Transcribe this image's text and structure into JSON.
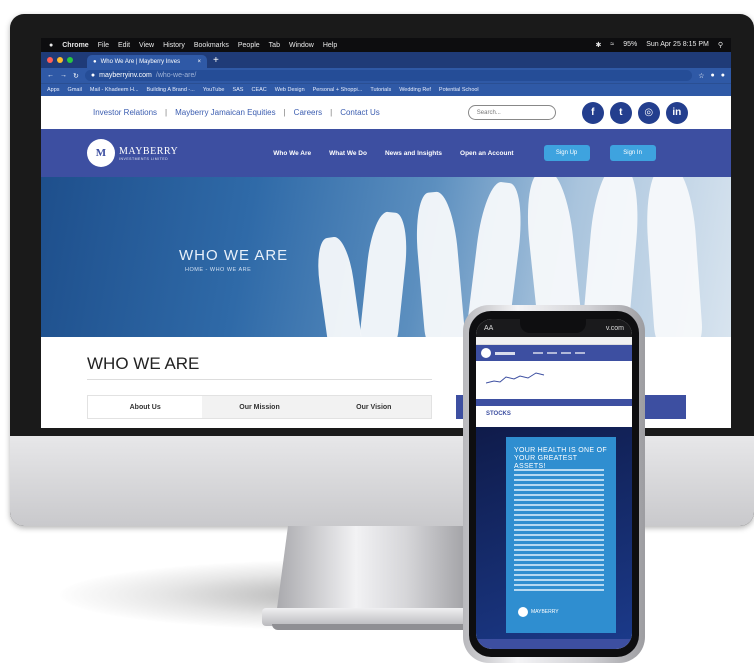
{
  "macbar": {
    "apple": "",
    "app": "Chrome",
    "menus": [
      "File",
      "Edit",
      "View",
      "History",
      "Bookmarks",
      "People",
      "Tab",
      "Window",
      "Help"
    ],
    "battery": "95%",
    "datetime": "Sun Apr 25  8:15 PM"
  },
  "browser": {
    "tab_title": "Who We Are | Mayberry Inves",
    "url_host": "mayberryinv.com",
    "url_path": "/who-we-are/",
    "bookmarks": [
      "Apps",
      "Gmail",
      "Mail - Khadeem H...",
      "Building A Brand -...",
      "YouTube",
      "SAS",
      "CEAC",
      "Web Design",
      "Personal + Shoppi...",
      "Tutorials",
      "Wedding Ref",
      "Potential School"
    ]
  },
  "site": {
    "topnav": [
      "Investor Relations",
      "Mayberry Jamaican Equities",
      "Careers",
      "Contact Us"
    ],
    "separator": "|",
    "search_placeholder": "Search...",
    "social": [
      "f",
      "t",
      "◎",
      "in"
    ],
    "logo_mark": "M",
    "logo_text": "MAYBERRY",
    "logo_sub": "INVESTMENTS LIMITED",
    "mainnav": [
      "Who We Are",
      "What We Do",
      "News and Insights",
      "Open an Account"
    ],
    "signup": "Sign Up",
    "signin": "Sign In",
    "hero_title": "WHO WE ARE",
    "hero_crumb": "HOME - WHO WE ARE",
    "section_title": "WHO WE ARE",
    "tabs": [
      "About Us",
      "Our Mission",
      "Our Vision"
    ]
  },
  "phone": {
    "status_left": "AA",
    "status_right": "v.com",
    "stocks_label": "STOCKS",
    "health_line1": "YOUR HEALTH IS ONE OF",
    "health_line2": "YOUR GREATEST ASSETS!",
    "logo_text": "MAYBERRY"
  },
  "colors": {
    "brand_blue": "#3d4fa1",
    "accent": "#3ea3df",
    "chrome_blue": "#2f59a6"
  }
}
